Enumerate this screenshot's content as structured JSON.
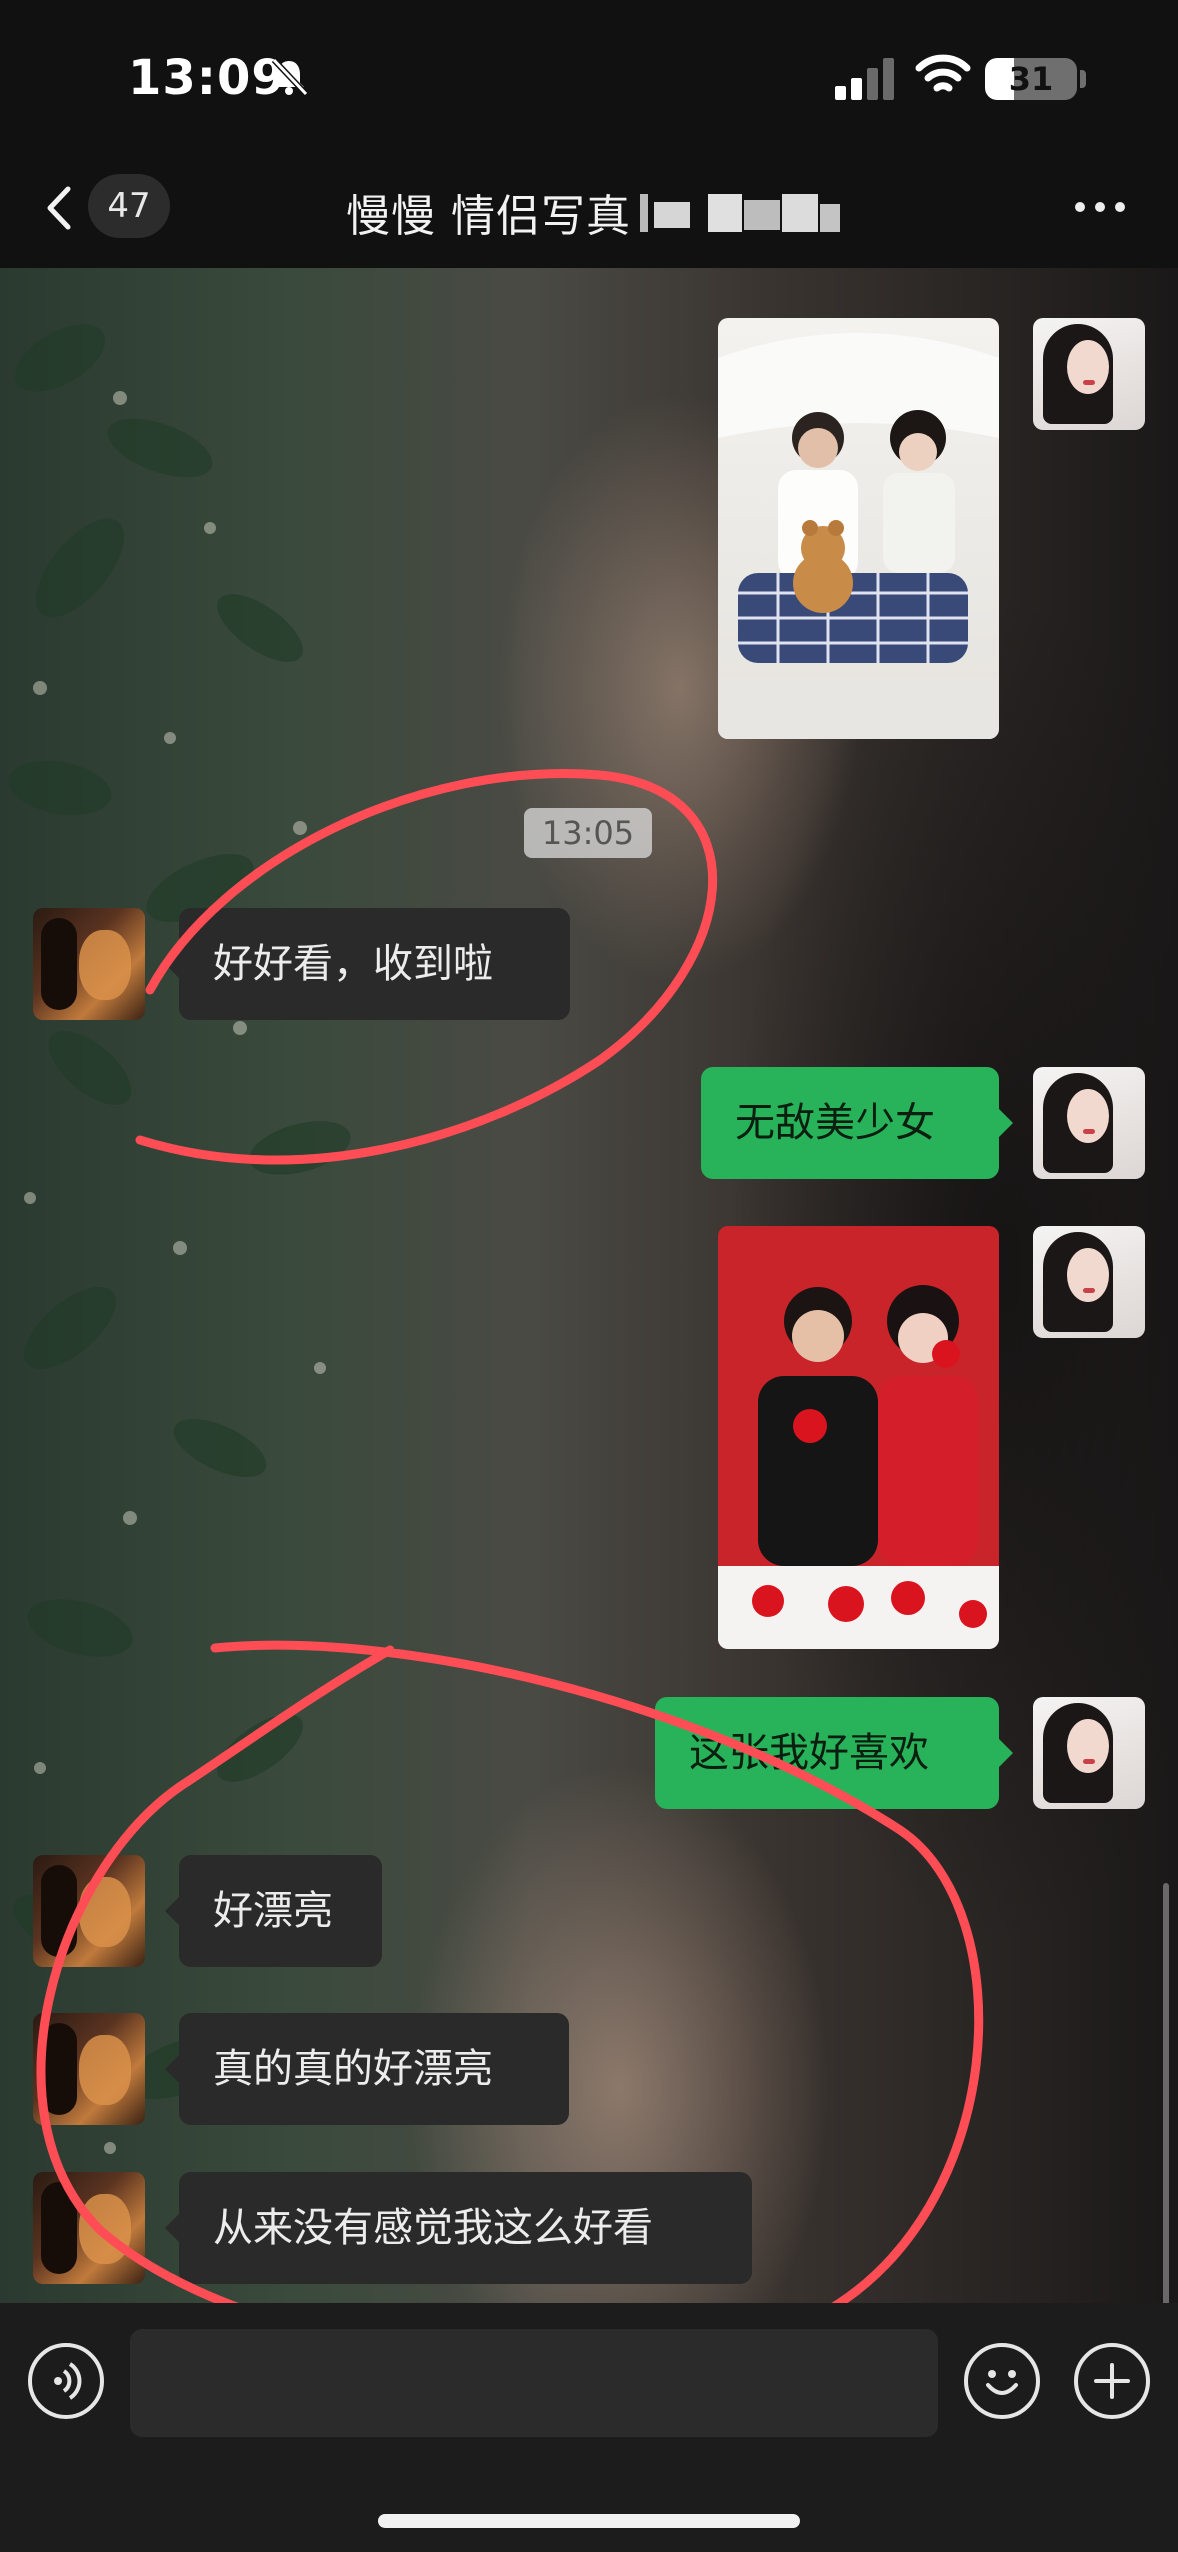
{
  "status_bar": {
    "time": "13:09",
    "battery": "31",
    "battery_level": 0.31
  },
  "header": {
    "unread_count": "47",
    "title": "慢慢 情侣写真"
  },
  "messages": {
    "timestamp": "13:05",
    "m1": "好好看，收到啦",
    "m2": "无敌美少女",
    "m3": "这张我好喜欢",
    "m4": "好漂亮",
    "m5": "真的真的好漂亮",
    "m6": "从来没有感觉我这么好看"
  },
  "input": {
    "placeholder": ""
  },
  "colors": {
    "outgoing_bubble": "#28b35a",
    "incoming_bubble": "#2a2a2a",
    "annotation_stroke": "#ff4d55"
  },
  "icons": [
    "mute-bell-icon",
    "cellular-signal-icon",
    "wifi-icon",
    "battery-icon",
    "back-chevron-icon",
    "more-icon",
    "voice-icon",
    "emoji-icon",
    "plus-icon"
  ]
}
